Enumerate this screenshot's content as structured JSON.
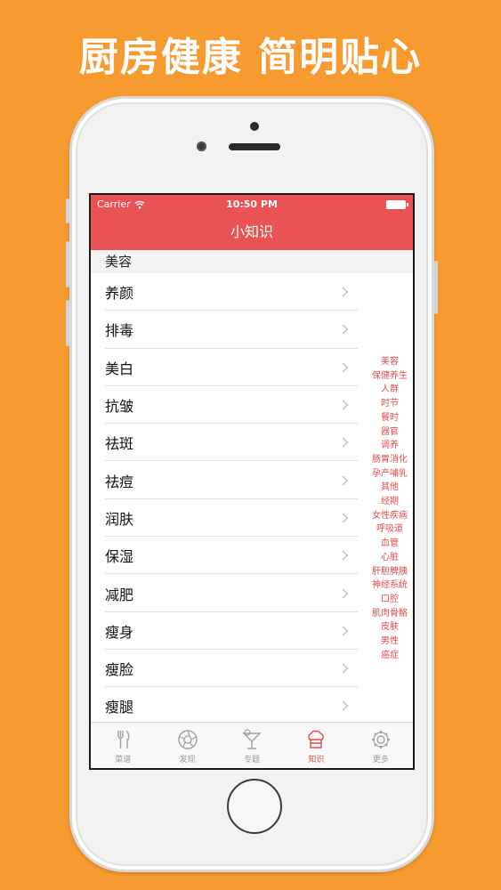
{
  "headline": "厨房健康 简明贴心",
  "status": {
    "carrier": "Carrier",
    "time": "10:50 PM"
  },
  "nav": {
    "title": "小知识"
  },
  "section": {
    "title": "美容"
  },
  "items": [
    "养颜",
    "排毒",
    "美白",
    "抗皱",
    "祛斑",
    "祛痘",
    "润肤",
    "保湿",
    "减肥",
    "瘦身",
    "瘦脸",
    "瘦腿"
  ],
  "index": [
    "美容",
    "保健养生",
    "人群",
    "时节",
    "餐时",
    "器官",
    "调养",
    "肠胃消化",
    "孕产哺乳",
    "其他",
    "经期",
    "女性疾病",
    "呼吸道",
    "血管",
    "心脏",
    "肝胆脾胰",
    "神经系统",
    "口腔",
    "肌肉骨骼",
    "皮肤",
    "男性",
    "癌症"
  ],
  "tabs": [
    {
      "label": "菜谱",
      "icon": "fork-knife-icon"
    },
    {
      "label": "发现",
      "icon": "aperture-icon"
    },
    {
      "label": "专题",
      "icon": "cocktail-icon"
    },
    {
      "label": "知识",
      "icon": "chef-hat-icon"
    },
    {
      "label": "更多",
      "icon": "gear-icon"
    }
  ],
  "colors": {
    "accent": "#e95353",
    "background": "#f79a30",
    "index_text": "#e64b4b"
  }
}
